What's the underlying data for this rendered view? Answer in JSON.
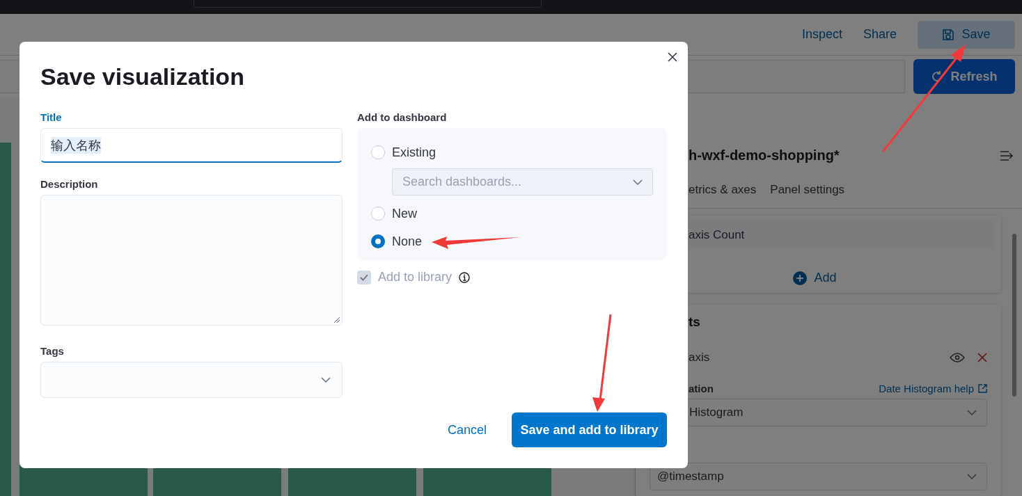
{
  "header": {
    "links": [
      "Inspect",
      "Share"
    ],
    "save_button": "Save"
  },
  "query_bar": {
    "refresh_button": "Refresh"
  },
  "side_panel": {
    "title": "h-wxf-demo-shopping*",
    "tabs": [
      "etrics & axes",
      "Panel settings"
    ],
    "metrics_card": {
      "item": "axis Count",
      "add_button": "Add"
    },
    "buckets_card": {
      "title": "ts",
      "item": "axis",
      "aggregation_label": "ation",
      "help_link": "Date Histogram help",
      "aggregation_select": "Histogram",
      "field_select": "@timestamp"
    }
  },
  "modal": {
    "title": "Save visualization",
    "title_field": {
      "label": "Title",
      "value": "输入名称"
    },
    "description": {
      "label": "Description"
    },
    "tags": {
      "label": "Tags"
    },
    "dashboard": {
      "label": "Add to dashboard",
      "search_placeholder": "Search dashboards...",
      "options": [
        {
          "label": "Existing",
          "selected": false
        },
        {
          "label": "New",
          "selected": false
        },
        {
          "label": "None",
          "selected": true
        }
      ]
    },
    "library": {
      "label": "Add to library",
      "checked": true
    },
    "cancel_button": "Cancel",
    "submit_button": "Save and add to library"
  }
}
